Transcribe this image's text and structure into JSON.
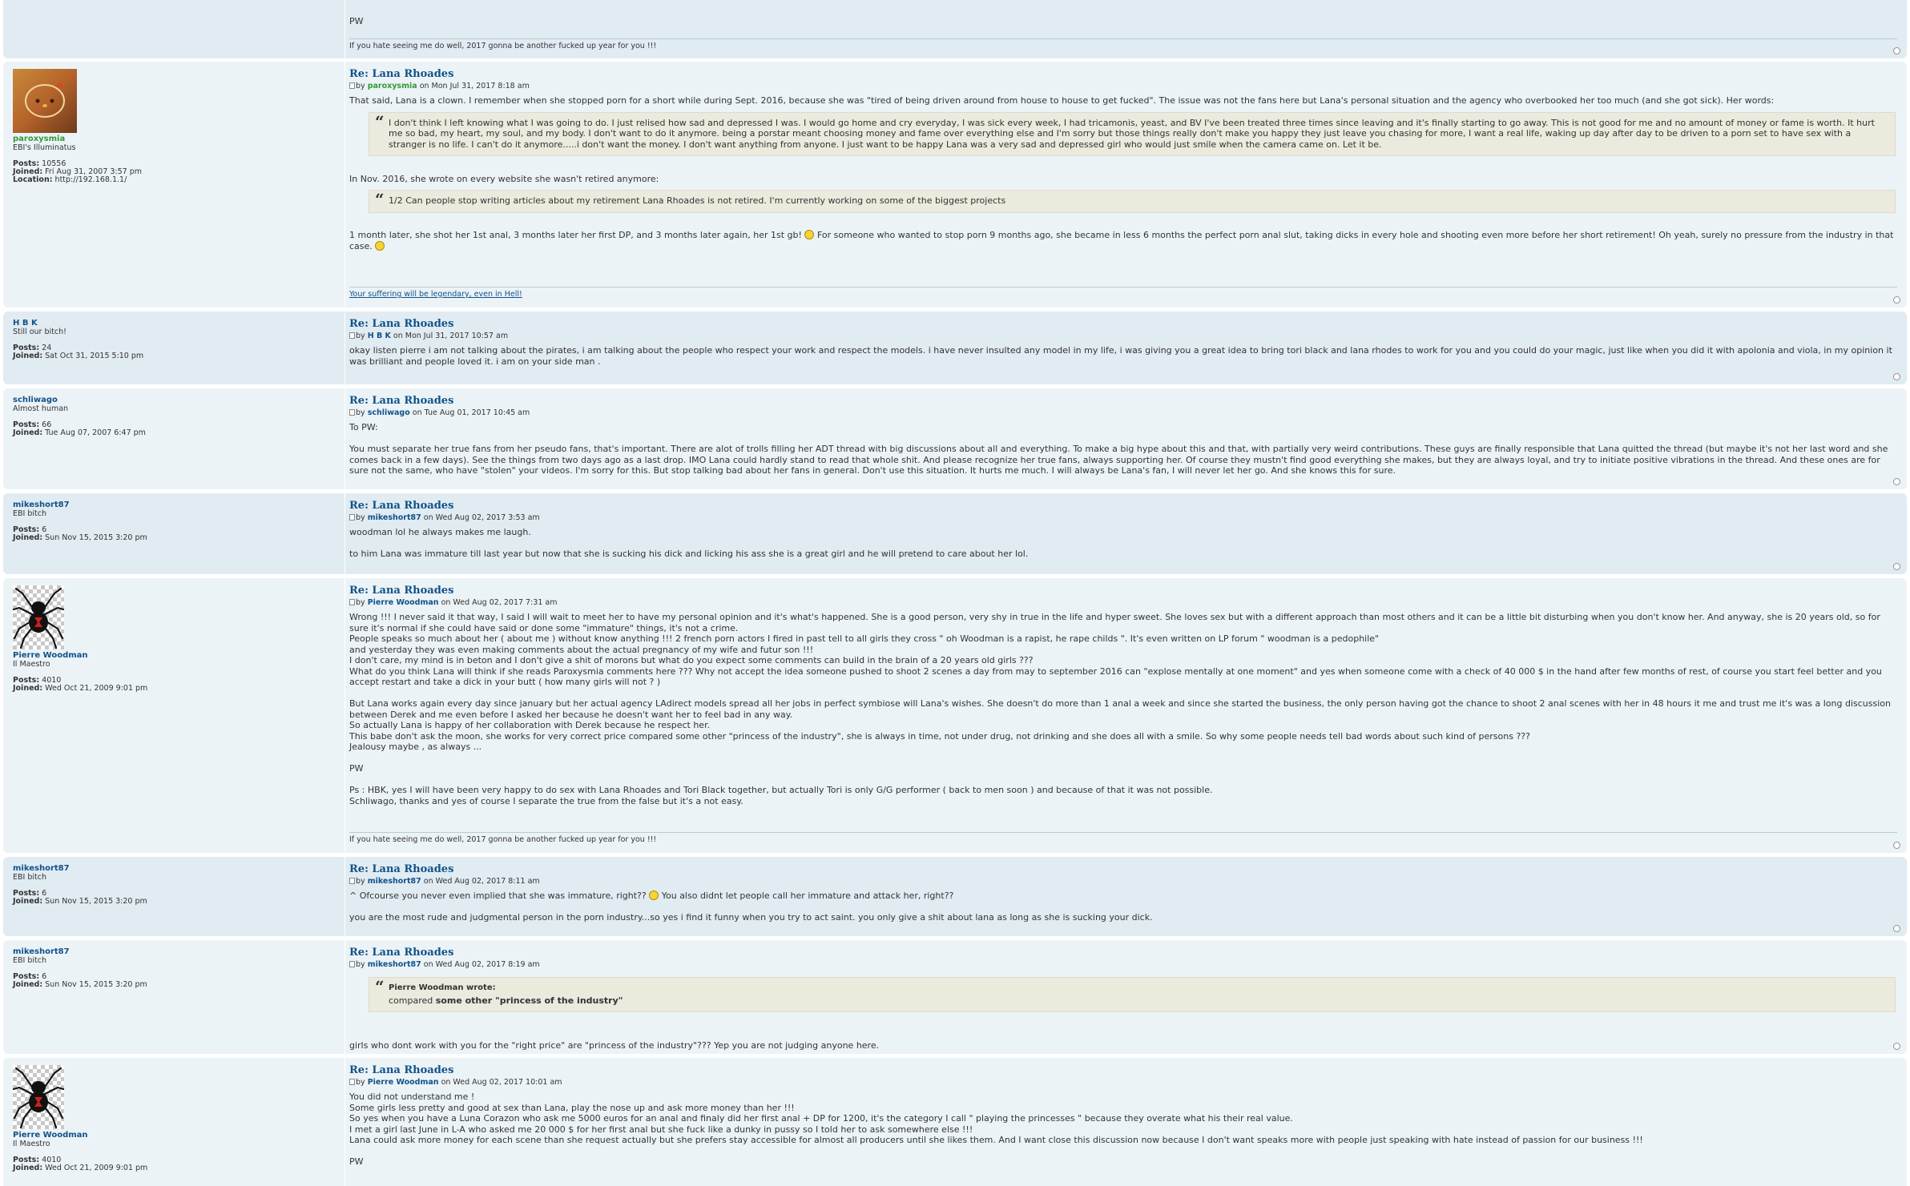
{
  "sig_pw": "If you hate seeing me do well, 2017 gonna be another fucked up year for you !!!",
  "sig_par": "Your suffering will be legendary, even in Hell!",
  "partial": {
    "pw": "PW"
  },
  "posts": [
    {
      "user": "paroxysmia",
      "rank": "EBI's Illuminatus",
      "posts_label": "Posts:",
      "posts": "10556",
      "joined_label": "Joined:",
      "joined": "Fri Aug 31, 2007 3:57 pm",
      "location_label": "Location:",
      "location": "http://192.168.1.1/",
      "title": "Re: Lana Rhoades",
      "by": "by",
      "on": "on Mon Jul 31, 2017 8:18 am",
      "p1": "That said, Lana is a clown. I remember when she stopped porn for a short while during Sept. 2016, because she was \"tired of being driven around from house to house to get fucked\". The issue was not the fans here but Lana's personal situation and the agency who overbooked her too much (and she got sick). Her words:",
      "q1": "I don't think I left knowing what I was going to do. I just relised how sad and depressed I was. I would go home and cry everyday, I was sick every week, I had tricamonis, yeast, and BV I've been treated three times since leaving and it's finally starting to go away. This is not good for me and no amount of money or fame is worth. It hurt me so bad, my heart, my soul, and my body. I don't want to do it anymore. being a porstar meant choosing money and fame over everything else and I'm sorry but those things really don't make you happy they just leave you chasing for more, I want a real life, waking up day after day to be driven to a porn set to have sex with a stranger is no life. I can't do it anymore.....i don't want the money. I don't want anything from anyone. I just want to be happy Lana was a very sad and depressed girl who would just smile when the camera came on. Let it be.",
      "p2": "In Nov. 2016, she wrote on every website she wasn't retired anymore:",
      "q2": "1/2 Can people stop writing articles about my retirement Lana Rhoades is not retired. I'm currently working on some of the biggest projects",
      "p3a": "1 month later, she shot her 1st anal, 3 months later her first DP, and 3 months later again, her 1st gb!",
      "p3b": "For someone who wanted to stop porn 9 months ago, she became in less 6 months the perfect porn anal slut, taking dicks in every hole and shooting even more before her short retirement! Oh yeah, surely no pressure from the industry in that case."
    },
    {
      "user": "H B K",
      "rank": "Still our bitch!",
      "posts_label": "Posts:",
      "posts": "24",
      "joined_label": "Joined:",
      "joined": "Sat Oct 31, 2015 5:10 pm",
      "title": "Re: Lana Rhoades",
      "by": "by",
      "on": "on Mon Jul 31, 2017 10:57 am",
      "p1": "okay listen pierre i am not talking about the pirates, i am talking about the people who respect your work and respect the models. i have never insulted any model in my life, i was giving you a great idea to bring tori black and lana rhodes to work for you and you could do your magic, just like when you did it with apolonia and viola, in my opinion it was brilliant and people loved it. i am on your side man ."
    },
    {
      "user": "schliwago",
      "rank": "Almost human",
      "posts_label": "Posts:",
      "posts": "66",
      "joined_label": "Joined:",
      "joined": "Tue Aug 07, 2007 6:47 pm",
      "title": "Re: Lana Rhoades",
      "by": "by",
      "on": "on Tue Aug 01, 2017 10:45 am",
      "p1": "To PW:",
      "p2": "You must separate her true fans from her pseudo fans, that's important. There are alot of trolls filling her ADT thread with big discussions about all and everything. To make a big hype about this and that, with partially very weird contributions. These guys are finally responsible that Lana quitted the thread (but maybe it's not her last word and she comes back in a few days). See the things from two days ago as a last drop. IMO Lana could hardly stand to read that whole shit. And please recognize her true fans, always supporting her. Of course they mustn't find good everything she makes, but they are always loyal, and try to initiate positive vibrations in the thread. And these ones are for sure not the same, who have \"stolen\" your videos. I'm sorry for this. But stop talking bad about her fans in general. Don't use this situation. It hurts me much. I will always be Lana's fan, I will never let her go. And she knows this for sure."
    },
    {
      "user": "mikeshort87",
      "rank": "EBI bitch",
      "posts_label": "Posts:",
      "posts": "6",
      "joined_label": "Joined:",
      "joined": "Sun Nov 15, 2015 3:20 pm",
      "title": "Re: Lana Rhoades",
      "by": "by",
      "on": "on Wed Aug 02, 2017 3:53 am",
      "p1": "woodman lol he always makes me laugh.",
      "p2": "to him Lana was immature till last year but now that she is sucking his dick and licking his ass she is a great girl and he will pretend to care about her lol."
    },
    {
      "user": "Pierre Woodman",
      "rank": "Il Maestro",
      "posts_label": "Posts:",
      "posts": "4010",
      "joined_label": "Joined:",
      "joined": "Wed Oct 21, 2009 9:01 pm",
      "title": "Re: Lana Rhoades",
      "by": "by",
      "on": "on Wed Aug 02, 2017 7:31 am",
      "lines": [
        "Wrong !!! I never said it that way, I said I will wait to meet her to have my personal opinion and it's what's happened. She is a good person, very shy in true in the life and hyper sweet. She loves sex but with a different approach than most others and it can be a little bit disturbing when you don't know her. And anyway, she is 20 years old, so for sure it's normal if she could have said or done some \"immature\" things, it's not a crime.",
        "People speaks so much about her ( about me ) without know anything !!! 2 french porn actors I fired in past tell to all girls they cross \" oh Woodman is a rapist, he rape childs \". It's even written on LP forum \" woodman is a pedophile\"",
        "and yesterday they was even making comments about the actual pregnancy of my wife and futur son !!!",
        "I don't care, my mind is in beton and I don't give a shit of morons but what do you expect some comments can build in the brain of a 20 years old girls ???",
        "What do you think Lana will think if she reads Paroxysmia comments here ??? Why not accept the idea someone pushed to shoot 2 scenes a day from may to september 2016 can \"explose mentally at one moment\" and yes when someone come with a check of 40 000 $ in the hand after few months of rest, of course you start feel better and you accept restart and take a dick in your butt ( how many girls will not ? )",
        "",
        "But Lana works again every day since january but her actual agency LAdirect models spread all her jobs in perfect symbiose will Lana's wishes. She doesn't do more than 1 anal a week and since she started the business, the only person having got the chance to shoot 2 anal scenes with her in 48 hours it me and trust me it's was a long discussion between Derek and me even before I asked her because he doesn't want her to feel bad in any way.",
        "So actually Lana is happy of her collaboration with Derek because he respect her.",
        "This babe don't ask the moon, she works for very correct price compared some other \"princess of the industry\", she is always in time, not under drug, not drinking and she does all with a smile. So why some people needs tell bad words about such kind of persons ???",
        "Jealousy maybe , as always ...",
        "",
        "PW",
        "",
        "Ps : HBK, yes I will have been very happy to do sex with Lana Rhoades and Tori Black together, but actually Tori is only G/G performer ( back to men soon ) and because of that it was not possible.",
        "Schliwago, thanks and yes of course I separate the true from the false but it's a not easy."
      ]
    },
    {
      "user": "mikeshort87",
      "rank": "EBI bitch",
      "posts_label": "Posts:",
      "posts": "6",
      "joined_label": "Joined:",
      "joined": "Sun Nov 15, 2015 3:20 pm",
      "title": "Re: Lana Rhoades",
      "by": "by",
      "on": "on Wed Aug 02, 2017 8:11 am",
      "p1a": "^ Ofcourse you never even implied that she was immature, right??",
      "p1b": "You also didnt let people call her immature and attack her, right??",
      "p2": "you are the most rude and judgmental person in the porn industry...so yes i find it funny when you try to act saint. you only give a shit about lana as long as she is sucking your dick."
    },
    {
      "user": "mikeshort87",
      "rank": "EBI bitch",
      "posts_label": "Posts:",
      "posts": "6",
      "joined_label": "Joined:",
      "joined": "Sun Nov 15, 2015 3:20 pm",
      "title": "Re: Lana Rhoades",
      "by": "by",
      "on": "on Wed Aug 02, 2017 8:19 am",
      "qhead": "Pierre Woodman wrote:",
      "q_plain": "compared",
      "q_bold": "some other \"princess of the industry\"",
      "p1": "girls who dont work with you for the \"right price\" are \"princess of the industry\"??? Yep you are not judging anyone here."
    },
    {
      "user": "Pierre Woodman",
      "rank": "Il Maestro",
      "posts_label": "Posts:",
      "posts": "4010",
      "joined_label": "Joined:",
      "joined": "Wed Oct 21, 2009 9:01 pm",
      "title": "Re: Lana Rhoades",
      "by": "by",
      "on": "on Wed Aug 02, 2017 10:01 am",
      "lines": [
        "You did not understand me !",
        "Some girls less pretty and good at sex than Lana, play the nose up and ask more money than her !!!",
        "So yes when you have a Luna Corazon who ask me 5000 euros for an anal and finaly did her first anal + DP for 1200, it's the category I call \" playing the princesses \" because they overate what his their real value.",
        "I met a girl last June in L-A who asked me 20 000 $ for her first anal but she fuck like a dunky in pussy so I told her to ask somewhere else !!!",
        "Lana could ask more money for each scene than she request actually but she prefers stay accessible for almost all producers until she likes them. And I want close this discussion now because I don't want speaks more with people just speaking with hate instead of passion for our business !!!",
        "",
        "PW"
      ]
    }
  ]
}
